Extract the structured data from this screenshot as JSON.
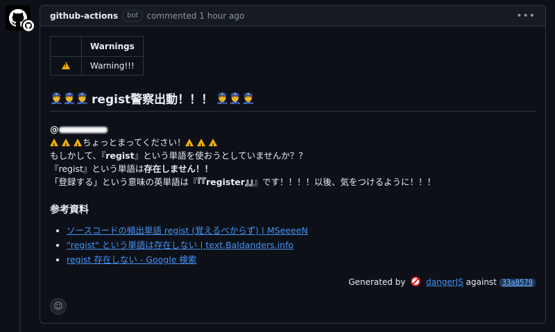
{
  "comment": {
    "author": "github-actions",
    "badge": "bot",
    "meta": "commented 1 hour ago",
    "menu_icon": "kebab-horizontal-icon"
  },
  "warnings_table": {
    "header": "Warnings",
    "rows": [
      {
        "icon": "warning-icon",
        "text": "Warning!!!"
      }
    ]
  },
  "heading": {
    "emoji": "police-officer-icon",
    "text": "regist警察出動！！！"
  },
  "message": {
    "mention_prefix": "@",
    "line1": "ちょっとまってください！",
    "line2_a": "もしかして、『",
    "line2_b": "regist",
    "line2_c": "』という単語を使おうとしていませんか？？",
    "line3_a": "『regist』という単語は",
    "line3_b": "存在しません！！",
    "line4_a": "「登録する」という意味の英単語は『",
    "line4_b": "『『register』』",
    "line4_c": "』です！！！！以後、気をつけるように！！！"
  },
  "references": {
    "title": "参考資料",
    "links": [
      "ソースコードの頻出単語 regist (覚えるべからず) | MSeeeeN",
      "\"regist\" という単語は存在しない | text.Baldanders.info",
      "regist 存在しない - Google 検索"
    ]
  },
  "footer": {
    "generated_by": "Generated by",
    "tool": "dangerJS",
    "against": "against",
    "sha": "33a8579"
  },
  "reaction_icon": "smiley-icon",
  "colors": {
    "link": "#4493f8",
    "background": "#0d1117",
    "border": "#30363d"
  }
}
